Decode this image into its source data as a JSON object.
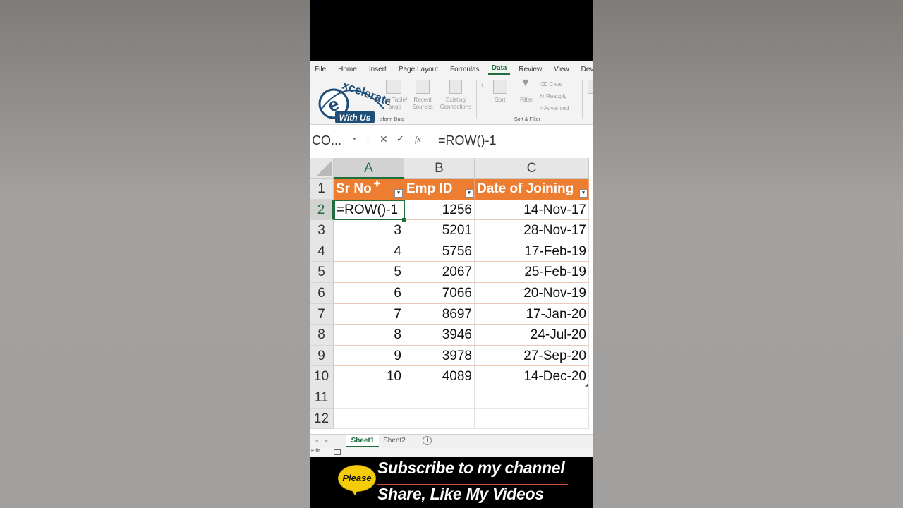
{
  "ribbon": {
    "tabs": [
      "File",
      "Home",
      "Insert",
      "Page Layout",
      "Formulas",
      "Data",
      "Review",
      "View",
      "Develope"
    ],
    "active_tab": "Data",
    "items": {
      "from_table": "om Table/\nange",
      "recent_sources": "Recent\nSources",
      "existing_connections": "Existing\nConnections",
      "sort": "Sort",
      "filter": "Filter",
      "clear": "Clear",
      "reapply": "Reapply",
      "advanced": "Advanced"
    },
    "groups": {
      "transform": "sform Data",
      "sort_filter": "Sort & Filter"
    }
  },
  "logo": {
    "main": "excelerate",
    "sub": "With Us"
  },
  "formula_bar": {
    "name_box": "CO...",
    "dots": "⋮",
    "cancel": "✕",
    "enter": "✓",
    "fx": "fx",
    "formula": "=ROW()-1"
  },
  "columns": [
    "A",
    "B",
    "C"
  ],
  "row_numbers": [
    "1",
    "2",
    "3",
    "4",
    "5",
    "6",
    "7",
    "8",
    "9",
    "10",
    "11",
    "12"
  ],
  "table": {
    "headers": [
      "Sr No",
      "Emp ID",
      "Date of Joining"
    ],
    "rows": [
      [
        "=ROW()-1",
        "1256",
        "14-Nov-17"
      ],
      [
        "3",
        "5201",
        "28-Nov-17"
      ],
      [
        "4",
        "5756",
        "17-Feb-19"
      ],
      [
        "5",
        "2067",
        "25-Feb-19"
      ],
      [
        "6",
        "7066",
        "20-Nov-19"
      ],
      [
        "7",
        "8697",
        "17-Jan-20"
      ],
      [
        "8",
        "3946",
        "24-Jul-20"
      ],
      [
        "9",
        "3978",
        "27-Sep-20"
      ],
      [
        "10",
        "4089",
        "14-Dec-20"
      ]
    ]
  },
  "sheets": [
    "Sheet1",
    "Sheet2"
  ],
  "active_sheet": "Sheet1",
  "add_sheet": "+",
  "status": "Edit",
  "banner": {
    "badge": "Please",
    "line1": "Subscribe to my channel",
    "line2": "Share, Like My Videos"
  }
}
